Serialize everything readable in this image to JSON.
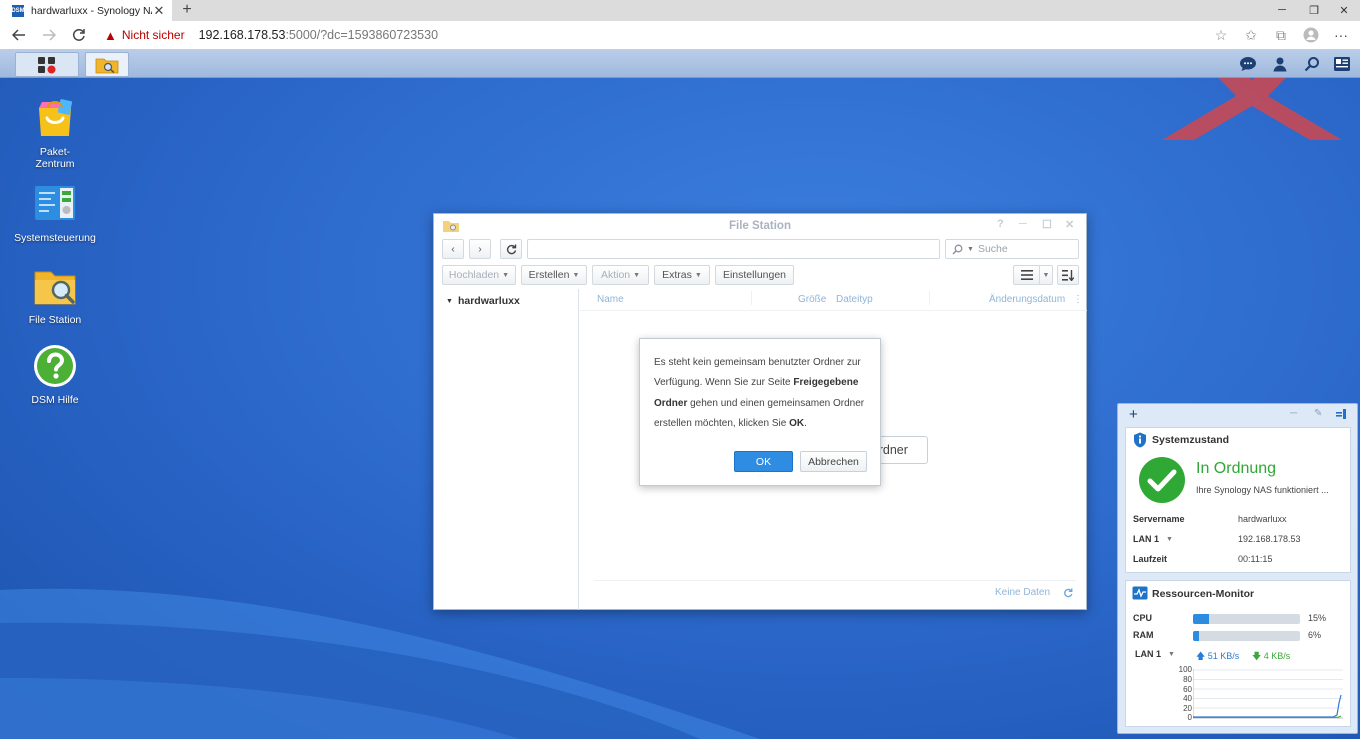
{
  "browser": {
    "tab_title": "hardwarluxx - Synology NAS",
    "favicon_text": "DSM",
    "close_tab": "✕",
    "new_tab": "+",
    "security_label": "Nicht sicher",
    "url_host": "192.168.178.53",
    "url_rest": ":5000/?dc=1593860723530",
    "window_controls": [
      "─",
      "❐",
      "✕"
    ],
    "menu_dots": "···"
  },
  "desktop": {
    "icons": [
      {
        "label_line1": "Paket-",
        "label_line2": "Zentrum",
        "icon": "package-center-icon"
      },
      {
        "label_line1": "Systemsteuerung",
        "label_line2": "",
        "icon": "control-panel-icon"
      },
      {
        "label_line1": "File Station",
        "label_line2": "",
        "icon": "file-station-icon"
      },
      {
        "label_line1": "DSM Hilfe",
        "label_line2": "",
        "icon": "help-icon"
      }
    ]
  },
  "file_station": {
    "title": "File Station",
    "search_placeholder": "Suche",
    "toolbar": {
      "upload": "Hochladen",
      "create": "Erstellen",
      "action": "Aktion",
      "extras": "Extras",
      "settings": "Einstellungen"
    },
    "tree_root": "hardwarluxx",
    "columns": {
      "name": "Name",
      "size": "Größe",
      "type": "Dateityp",
      "modified": "Änderungsdatum"
    },
    "footer_text": "Keine Daten",
    "behind_button_text": "Ordner"
  },
  "dialog": {
    "text_1": "Es steht kein gemeinsam benutzter Ordner zur Verfügung. Wenn Sie zur Seite ",
    "text_bold_1": "Freigegebene Ordner",
    "text_2": " gehen und einen gemeinsamen Ordner erstellen möchten, klicken Sie ",
    "text_bold_2": "OK",
    "text_3": ".",
    "ok_label": "OK",
    "cancel_label": "Abbrechen"
  },
  "widgets": {
    "add": "+",
    "system_health": {
      "title": "Systemzustand",
      "status": "In Ordnung",
      "status_detail": "Ihre Synology NAS funktioniert ...",
      "rows": [
        {
          "label": "Servername",
          "value": "hardwarluxx"
        },
        {
          "label": "LAN 1",
          "value": "192.168.178.53"
        },
        {
          "label": "Laufzeit",
          "value": "00:11:15"
        }
      ]
    },
    "resource_monitor": {
      "title": "Ressourcen-Monitor",
      "cpu_label": "CPU",
      "cpu_text": "15%",
      "cpu_percent": 15,
      "ram_label": "RAM",
      "ram_text": "6%",
      "ram_percent": 6,
      "lan_label": "LAN 1",
      "upload_text": "51 KB/s",
      "download_text": "4 KB/s",
      "chart_ticks": [
        "100",
        "80",
        "60",
        "40",
        "20",
        "0"
      ]
    }
  },
  "colors": {
    "accent": "#2e8ce3",
    "ok_green": "#28a745",
    "upload": "#2a7dd6",
    "download": "#3aa83a"
  }
}
